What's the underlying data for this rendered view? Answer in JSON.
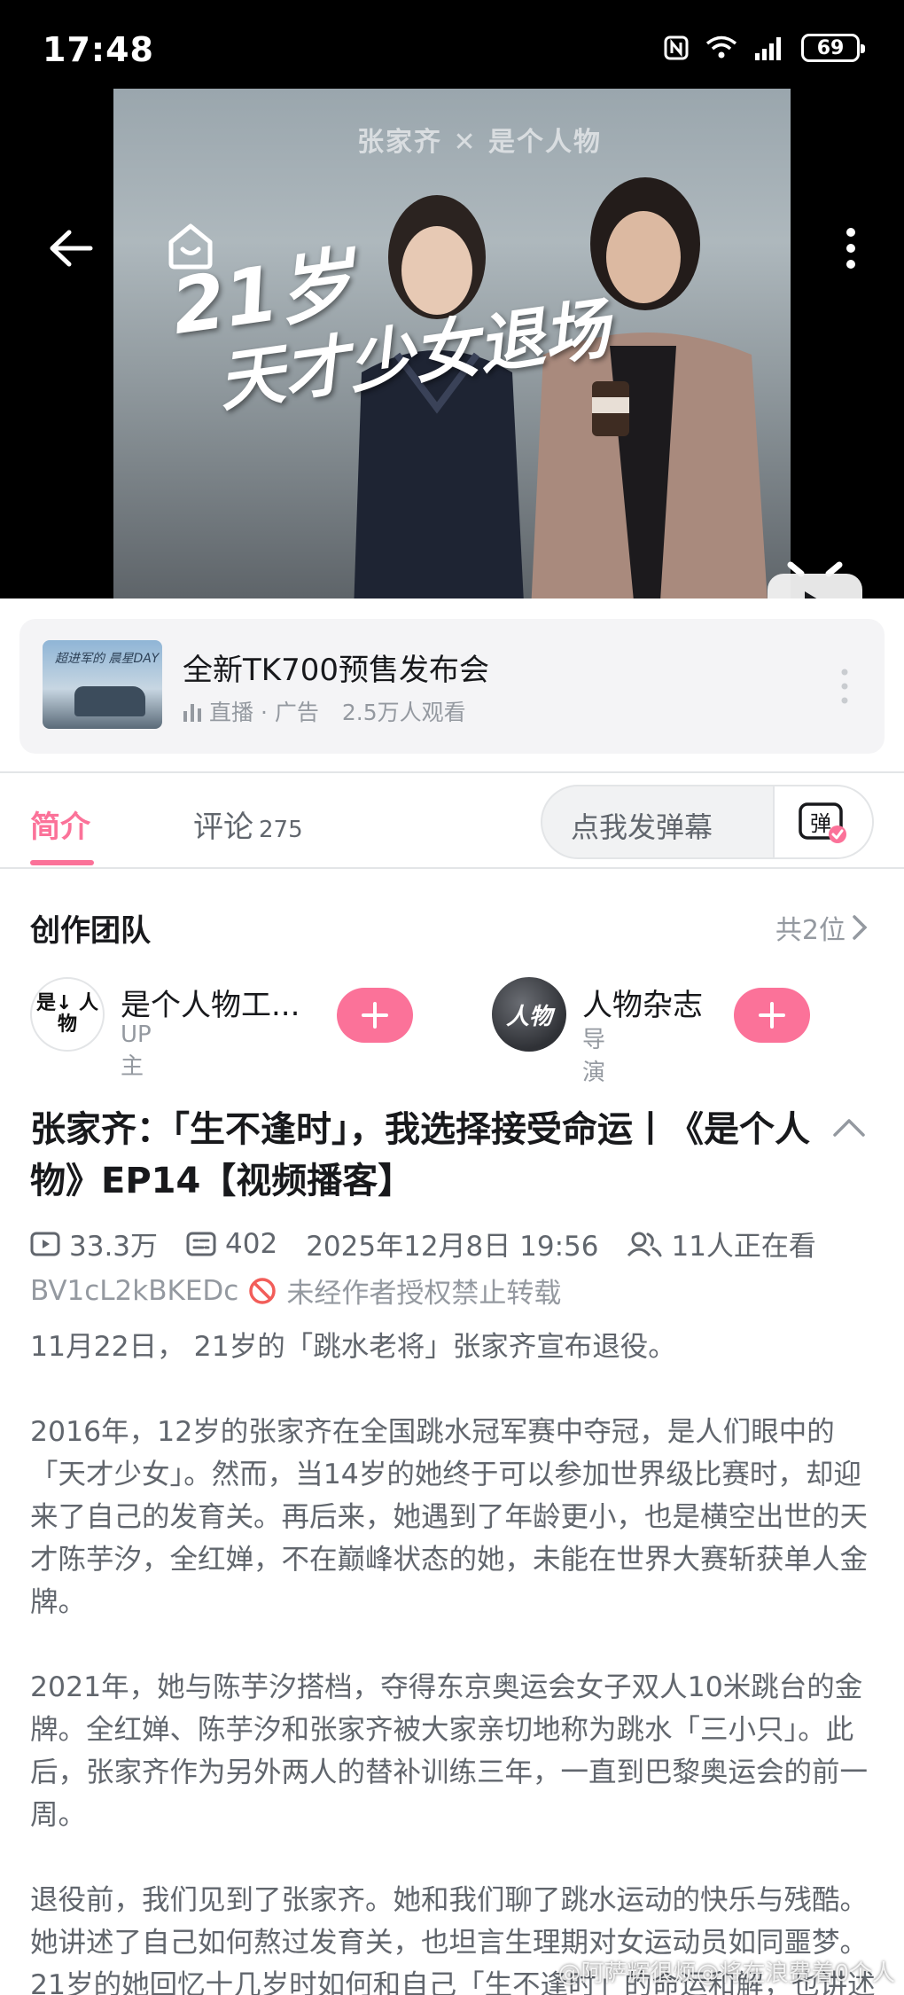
{
  "status_bar": {
    "time": "17:48",
    "battery": "69"
  },
  "video": {
    "brand": "张家齐 ✕ 是个人物",
    "title_line1": "21岁",
    "title_line2": "天才少女退场"
  },
  "ad": {
    "thumb_text": "超进军的 晨星DAY",
    "title": "全新TK700预售发布会",
    "live_label": "直播 · 广告",
    "viewers": "2.5万人观看"
  },
  "tabs": {
    "intro": "简介",
    "comments": "评论",
    "comments_count": "275",
    "danmaku_placeholder": "点我发弹幕",
    "danmaku_button": "弹"
  },
  "team": {
    "title": "创作团队",
    "count": "共2位",
    "creators": [
      {
        "avatar_text": "是↓ 人物",
        "name": "是个人物工...",
        "role": "UP主"
      },
      {
        "avatar_text": "人物",
        "name": "人物杂志",
        "role": "导演"
      }
    ]
  },
  "video_info": {
    "title": "张家齐：「生不逢时」，我选择接受命运丨《是个人物》EP14【视频播客】",
    "views": "33.3万",
    "danmaku_count": "402",
    "date": "2025年12月8日 19:56",
    "watching": "11人正在看",
    "bvid": "BV1cL2kBKEDc",
    "copyright": "未经作者授权禁止转载"
  },
  "description": [
    "11月22日， 21岁的「跳水老将」张家齐宣布退役。",
    "2016年，12岁的张家齐在全国跳水冠军赛中夺冠，是人们眼中的「天才少女」。然而，当14岁的她终于可以参加世界级比赛时，却迎来了自己的发育关。再后来，她遇到了年龄更小，也是横空出世的天才陈芋汐，全红婵，不在巅峰状态的她，未能在世界大赛斩获单人金牌。",
    "2021年，她与陈芋汐搭档，夺得东京奥运会女子双人10米跳台的金牌。全红婵、陈芋汐和张家齐被大家亲切地称为跳水「三小只」。此后，张家齐作为另外两人的替补训练三年，一直到巴黎奥运会的前一周。",
    "退役前，我们见到了张家齐。她和我们聊了跳水运动的快乐与残酷。她讲述了自己如何熬过发育关，也坦言生理期对女运动员如同噩梦。21岁的她回忆十几岁时如何和自己「生不逢时」的命运和解，也讲述了三个跳水天才少女之间的友谊。"
  ],
  "watermark": "@阿萨辉很烦@将在浪费着0个人",
  "colors": {
    "accent": "#fb7299",
    "text_primary": "#18191c",
    "text_secondary": "#61666d",
    "text_muted": "#9499a0"
  }
}
